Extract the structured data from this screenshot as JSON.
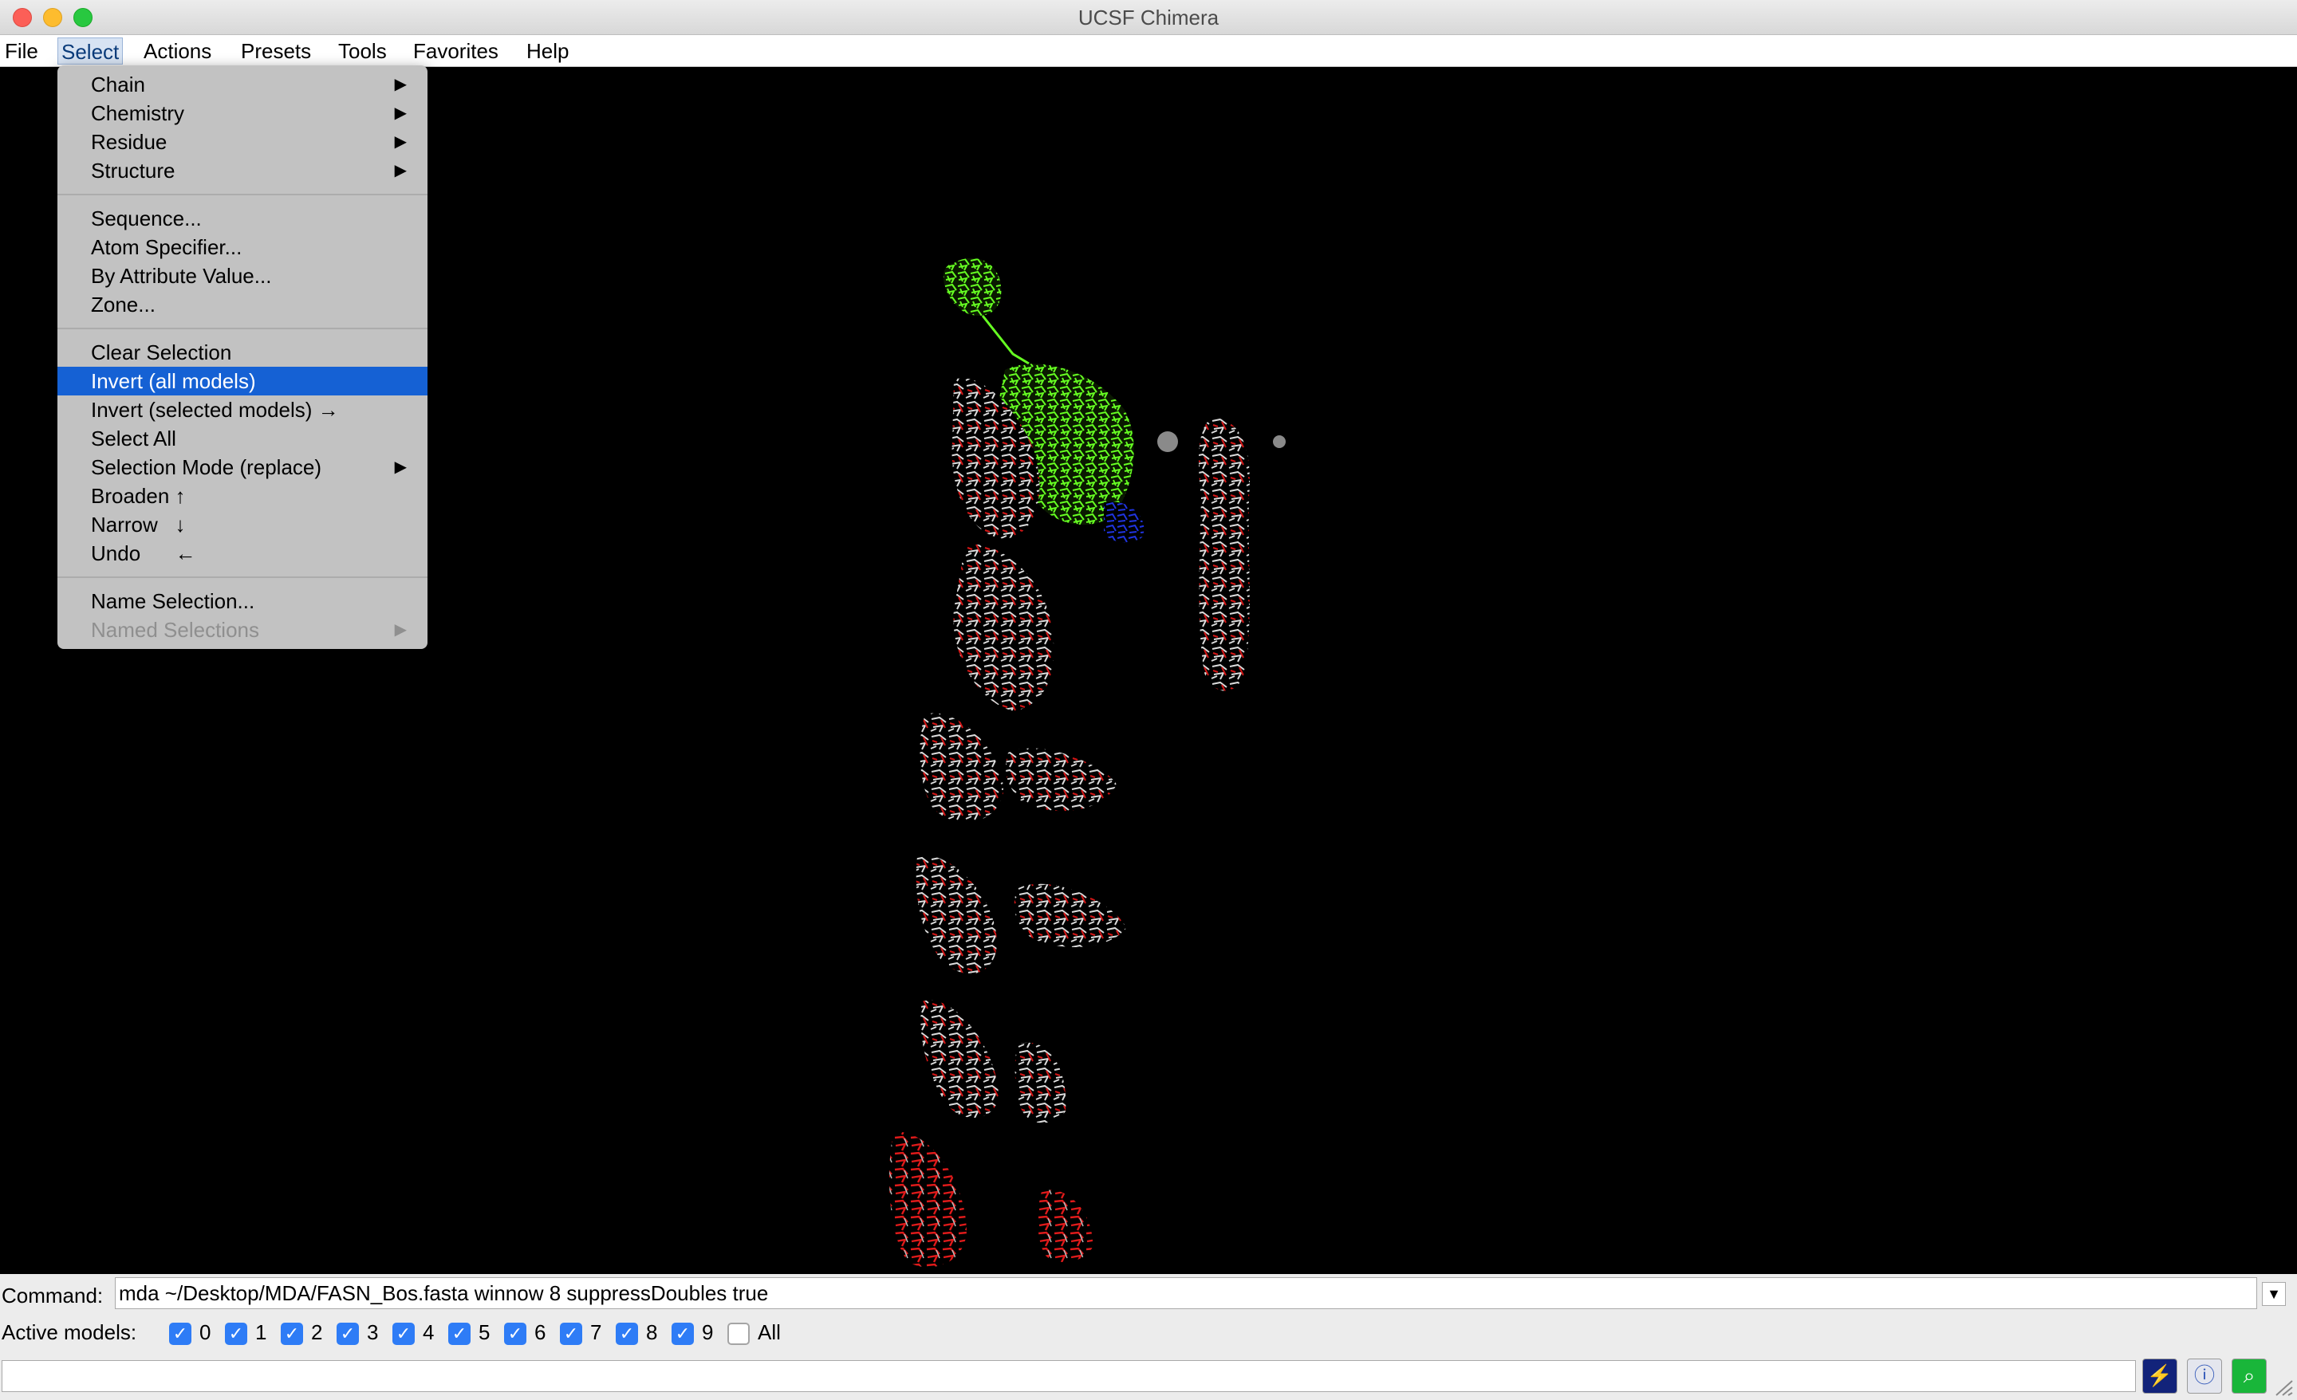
{
  "window": {
    "title": "UCSF Chimera"
  },
  "menubar": {
    "items": [
      {
        "label": "File"
      },
      {
        "label": "Select"
      },
      {
        "label": "Actions"
      },
      {
        "label": "Presets"
      },
      {
        "label": "Tools"
      },
      {
        "label": "Favorites"
      },
      {
        "label": "Help"
      }
    ],
    "active": "Select"
  },
  "select_menu": {
    "items": [
      {
        "label": "Chain",
        "submenu": true
      },
      {
        "label": "Chemistry",
        "submenu": true
      },
      {
        "label": "Residue",
        "submenu": true
      },
      {
        "label": "Structure",
        "submenu": true
      },
      {
        "label": "Sequence..."
      },
      {
        "label": "Atom Specifier..."
      },
      {
        "label": "By Attribute Value..."
      },
      {
        "label": "Zone..."
      },
      {
        "label": "Clear Selection"
      },
      {
        "label": "Invert (all models)",
        "highlighted": true
      },
      {
        "label": "Invert (selected models) →"
      },
      {
        "label": "Select All"
      },
      {
        "label": "Selection Mode (replace)",
        "submenu": true
      },
      {
        "label": "Broaden ↑"
      },
      {
        "label": "Narrow   ↓"
      },
      {
        "label": "Undo      ←"
      },
      {
        "label": "Name Selection..."
      },
      {
        "label": "Named Selections",
        "submenu": true,
        "disabled": true
      }
    ],
    "submenu_arrow": "▶"
  },
  "command": {
    "label": "Command:",
    "value": "mda ~/Desktop/MDA/FASN_Bos.fasta winnow 8 suppressDoubles true",
    "dropdown_glyph": "▼"
  },
  "active_models": {
    "label": "Active models:",
    "models": [
      {
        "label": "0",
        "checked": true
      },
      {
        "label": "1",
        "checked": true
      },
      {
        "label": "2",
        "checked": true
      },
      {
        "label": "3",
        "checked": true
      },
      {
        "label": "4",
        "checked": true
      },
      {
        "label": "5",
        "checked": true
      },
      {
        "label": "6",
        "checked": true
      },
      {
        "label": "7",
        "checked": true
      },
      {
        "label": "8",
        "checked": true
      },
      {
        "label": "9",
        "checked": true
      },
      {
        "label": "All",
        "checked": false
      }
    ],
    "check_glyph": "✓"
  },
  "status_bar": {
    "tools": [
      {
        "icon": "lightning-icon",
        "glyph": "⚡"
      },
      {
        "icon": "info-icon",
        "glyph": "ⓘ"
      },
      {
        "icon": "find-icon",
        "glyph": "⌕"
      }
    ]
  },
  "colors": {
    "selection_green": "#66ff22",
    "ribbon_red": "#d41616",
    "ribbon_white": "#dcdcdc",
    "ribbon_blue": "#1525c8",
    "menu_highlight": "#1561d4",
    "checkbox_blue": "#2e7cf6"
  }
}
